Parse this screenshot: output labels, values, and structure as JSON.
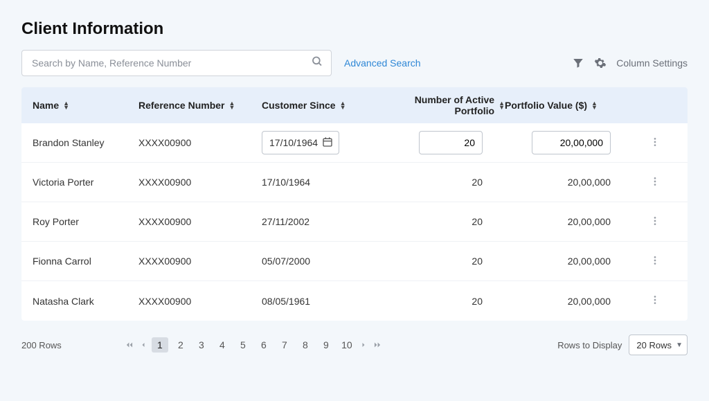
{
  "title": "Client Information",
  "search": {
    "placeholder": "Search by Name, Reference Number",
    "value": ""
  },
  "advanced_search_label": "Advanced Search",
  "column_settings_label": "Column Settings",
  "columns": {
    "name": "Name",
    "reference": "Reference Number",
    "since": "Customer Since",
    "portfolio_count": "Number of Active Portfolio",
    "portfolio_value": "Portfolio Value ($)"
  },
  "rows": [
    {
      "name": "Brandon Stanley",
      "reference": "XXXX00900",
      "since": "17/10/1964",
      "portfolio_count": "20",
      "portfolio_value": "20,00,000",
      "editing": true
    },
    {
      "name": "Victoria Porter",
      "reference": "XXXX00900",
      "since": "17/10/1964",
      "portfolio_count": "20",
      "portfolio_value": "20,00,000",
      "editing": false
    },
    {
      "name": "Roy Porter",
      "reference": "XXXX00900",
      "since": "27/11/2002",
      "portfolio_count": "20",
      "portfolio_value": "20,00,000",
      "editing": false
    },
    {
      "name": "Fionna Carrol",
      "reference": "XXXX00900",
      "since": "05/07/2000",
      "portfolio_count": "20",
      "portfolio_value": "20,00,000",
      "editing": false
    },
    {
      "name": "Natasha Clark",
      "reference": "XXXX00900",
      "since": "08/05/1961",
      "portfolio_count": "20",
      "portfolio_value": "20,00,000",
      "editing": false
    }
  ],
  "footer": {
    "rows_info": "200 Rows",
    "pages": [
      "1",
      "2",
      "3",
      "4",
      "5",
      "6",
      "7",
      "8",
      "9",
      "10"
    ],
    "active_page": "1",
    "rows_to_display_label": "Rows to Display",
    "rows_select_value": "20 Rows"
  }
}
